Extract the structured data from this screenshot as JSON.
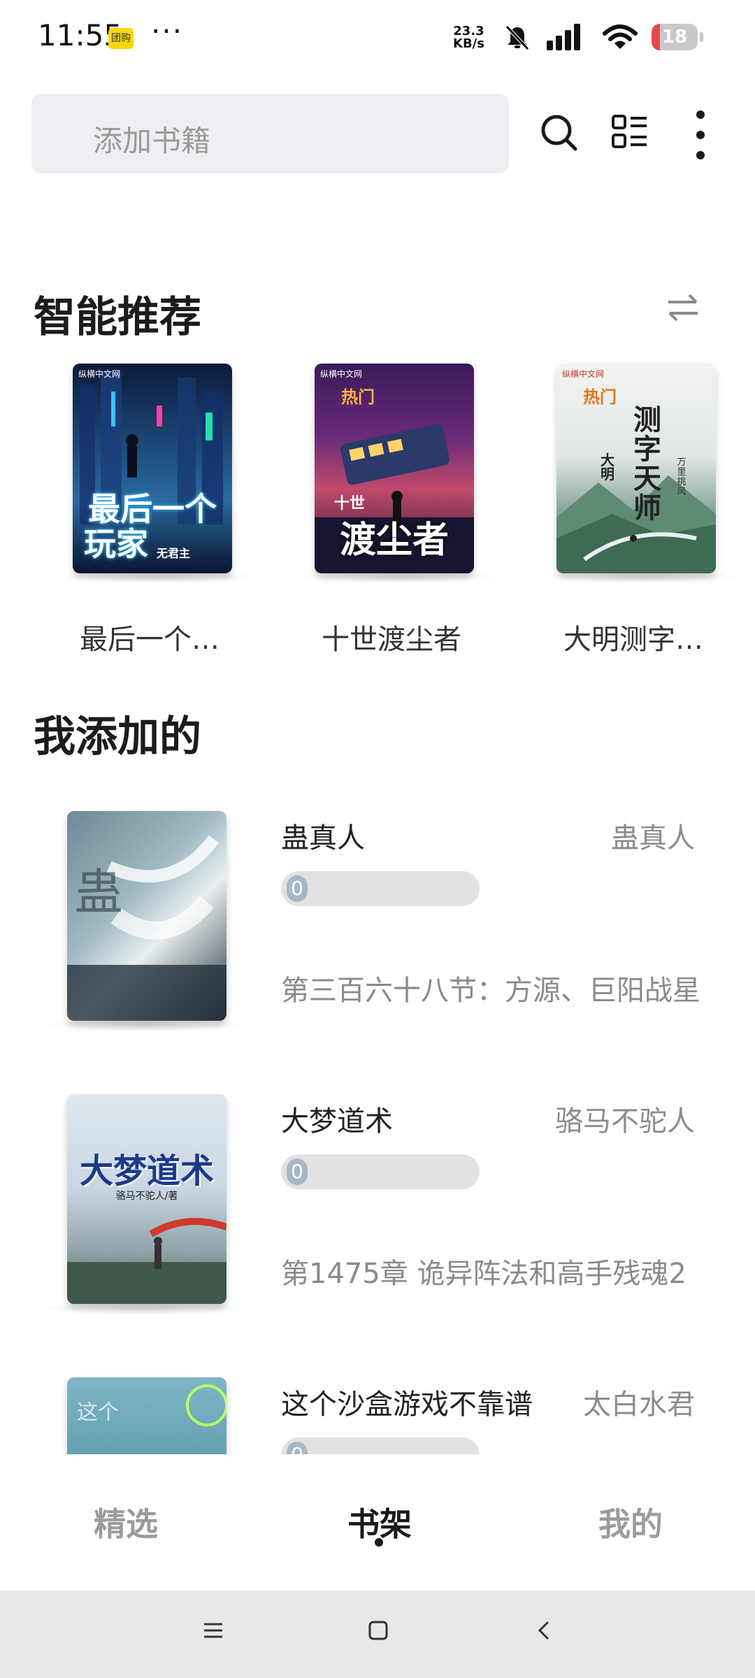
{
  "status_bar": {
    "time": "11:55",
    "app_badge": "团购",
    "more": "···",
    "net_speed_value": "23.3",
    "net_speed_unit": "KB/s",
    "battery_level": "18",
    "battery_fraction": 0.18,
    "battery_color": "#e5484d"
  },
  "header": {
    "search_placeholder": "添加书籍",
    "icons": [
      "search-icon",
      "list-view-icon",
      "more-vertical-icon"
    ]
  },
  "recommend": {
    "title": "智能推荐",
    "swap_icon": "swap-icon",
    "items": [
      {
        "title": "最后一个…",
        "cover_publisher": "纵横中文网",
        "cover_text_1": "最后一个",
        "cover_text_2": "玩家",
        "cover_author": "无君主"
      },
      {
        "title": "十世渡尘者",
        "cover_publisher": "纵横中文网",
        "cover_tag": "热门",
        "cover_text_1": "十世",
        "cover_text_2": "渡尘者"
      },
      {
        "title": "大明测字…",
        "cover_publisher": "纵横中文网",
        "cover_tag": "热门",
        "cover_text_1": "测字天师",
        "cover_text_2": "大明",
        "cover_author": "万里挑风"
      }
    ]
  },
  "shelf": {
    "title": "我添加的",
    "books": [
      {
        "title": "蛊真人",
        "author": "蛊真人",
        "progress": "0",
        "progress_fraction": 0.0,
        "chapter": "第三百六十八节：方源、巨阳战星"
      },
      {
        "title": "大梦道术",
        "author": "骆马不驼人",
        "progress": "0",
        "progress_fraction": 0.0,
        "chapter": "第1475章 诡异阵法和高手残魂2",
        "cover_text": "大梦道术",
        "cover_author": "骆马不驼人/著"
      },
      {
        "title": "这个沙盒游戏不靠谱",
        "author": "太白水君",
        "progress": "0",
        "progress_fraction": 0.0,
        "chapter": ""
      }
    ]
  },
  "tabs": [
    {
      "label": "精选",
      "active": false
    },
    {
      "label": "书架",
      "active": true
    },
    {
      "label": "我的",
      "active": false
    }
  ],
  "nav": {
    "icons": [
      "menu-icon",
      "home-icon",
      "back-icon"
    ]
  },
  "colors": {
    "accent": "#1a1a1a",
    "search_bg": "#eceef1",
    "progress_track": "#e2e2e2"
  }
}
